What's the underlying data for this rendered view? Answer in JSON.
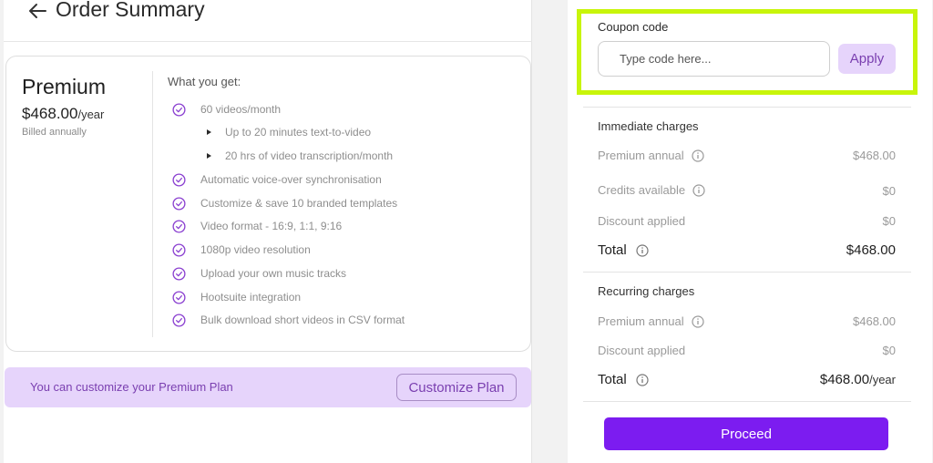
{
  "header": {
    "title": "Order Summary"
  },
  "plan": {
    "name": "Premium",
    "price": "$468.00",
    "period": "/year",
    "billing_note": "Billed annually",
    "features_title": "What you get:",
    "features": [
      "60 videos/month",
      "Automatic voice-over synchronisation",
      "Customize & save 10 branded templates",
      "Video format - 16:9, 1:1, 9:16",
      "1080p video resolution",
      "Upload your own music tracks",
      "Hootsuite integration",
      "Bulk download short videos in CSV format"
    ],
    "subfeatures": [
      "Up to 20 minutes text-to-video",
      "20 hrs of video transcription/month"
    ]
  },
  "banner": {
    "text": "You can customize your Premium Plan",
    "button_label": "Customize Plan"
  },
  "coupon": {
    "label": "Coupon code",
    "placeholder": "Type code here...",
    "apply_label": "Apply"
  },
  "immediate": {
    "title": "Immediate charges",
    "rows": [
      {
        "label": "Premium annual",
        "value": "$468.00"
      },
      {
        "label": "Credits available",
        "value": "$0"
      },
      {
        "label": "Discount applied",
        "value": "$0"
      }
    ],
    "total_label": "Total",
    "total_value": "$468.00"
  },
  "recurring": {
    "title": "Recurring charges",
    "rows": [
      {
        "label": "Premium annual",
        "value": "$468.00"
      },
      {
        "label": "Discount applied",
        "value": "$0"
      }
    ],
    "total_label": "Total",
    "total_value": "$468.00",
    "total_period": "/year"
  },
  "actions": {
    "proceed_label": "Proceed"
  },
  "colors": {
    "accent": "#7c1cf0",
    "accent_light": "#e6d4fb",
    "highlight": "#c8f50a",
    "check": "#8a3fd0"
  }
}
